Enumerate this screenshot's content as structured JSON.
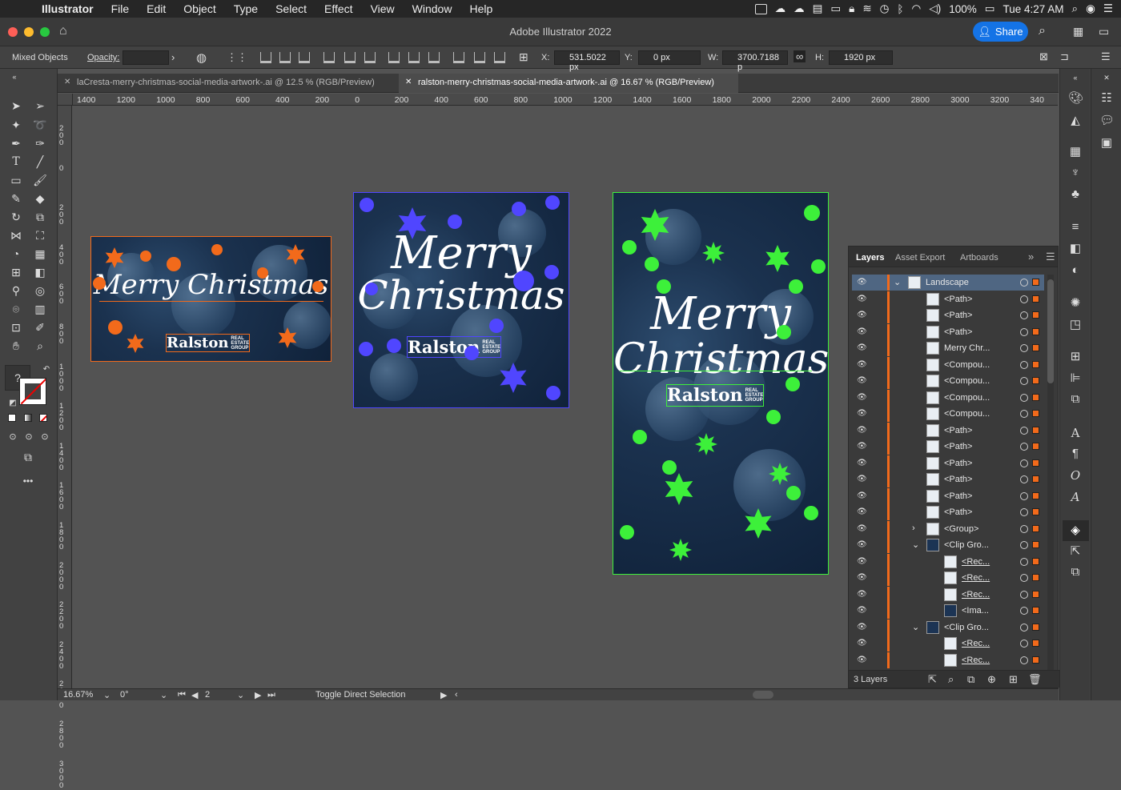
{
  "menubar": {
    "app": "Illustrator",
    "items": [
      "File",
      "Edit",
      "Object",
      "Type",
      "Select",
      "Effect",
      "View",
      "Window",
      "Help"
    ],
    "battery": "100%",
    "clock": "Tue 4:27 AM"
  },
  "window": {
    "title": "Adobe Illustrator 2022",
    "share_label": "Share"
  },
  "control": {
    "selection": "Mixed Objects",
    "opacity_label": "Opacity:",
    "x_label": "X:",
    "x_value": "531.5022 px",
    "y_label": "Y:",
    "y_value": "0 px",
    "w_label": "W:",
    "w_value": "3700.7188 p",
    "h_label": "H:",
    "h_value": "1920 px"
  },
  "tabs": [
    {
      "label": "laCresta-merry-christmas-social-media-artwork-.ai @ 12.5 % (RGB/Preview)"
    },
    {
      "label": "ralston-merry-christmas-social-media-artwork-.ai @ 16.67 % (RGB/Preview)"
    }
  ],
  "ruler_h": [
    "1400",
    "1200",
    "1000",
    "800",
    "600",
    "400",
    "200",
    "0",
    "200",
    "400",
    "600",
    "800",
    "1000",
    "1200",
    "1400",
    "1600",
    "1800",
    "2000",
    "2200",
    "2400",
    "2600",
    "2800",
    "3000",
    "3200",
    "340"
  ],
  "ruler_v": [
    "200",
    "0",
    "200",
    "400",
    "600",
    "800",
    "1000",
    "1200",
    "1400",
    "1600",
    "1800",
    "2000",
    "2200",
    "2400",
    "2600",
    "2800",
    "3000"
  ],
  "artwork": {
    "line1": "Merry Christmas",
    "merry": "Merry",
    "christmas": "Christmas",
    "logo": "Ralston",
    "logo_sub1": "REAL",
    "logo_sub2": "ESTATE",
    "logo_sub3": "GROUP",
    "colors": {
      "orange": "#f26a1b",
      "blue": "#5046ff",
      "green": "#3df03a"
    }
  },
  "layers": {
    "tabs": [
      "Layers",
      "Asset Export",
      "Artboards"
    ],
    "rows": [
      {
        "name": "Landscape"
      },
      {
        "name": "<Path>"
      },
      {
        "name": "<Path>"
      },
      {
        "name": "<Path>"
      },
      {
        "name": "Merry Chr..."
      },
      {
        "name": "<Compou..."
      },
      {
        "name": "<Compou..."
      },
      {
        "name": "<Compou..."
      },
      {
        "name": "<Compou..."
      },
      {
        "name": "<Path>"
      },
      {
        "name": "<Path>"
      },
      {
        "name": "<Path>"
      },
      {
        "name": "<Path>"
      },
      {
        "name": "<Path>"
      },
      {
        "name": "<Path>"
      },
      {
        "name": "<Group>"
      },
      {
        "name": "<Clip Gro..."
      },
      {
        "name": "<Rec..."
      },
      {
        "name": "<Rec..."
      },
      {
        "name": "<Rec..."
      },
      {
        "name": "<Ima..."
      },
      {
        "name": "<Clip Gro..."
      },
      {
        "name": "<Rec..."
      },
      {
        "name": "<Rec..."
      }
    ],
    "count": "3 Layers"
  },
  "status": {
    "zoom": "16.67%",
    "rotation": "0°",
    "artboard": "2",
    "tool": "Toggle Direct Selection"
  }
}
